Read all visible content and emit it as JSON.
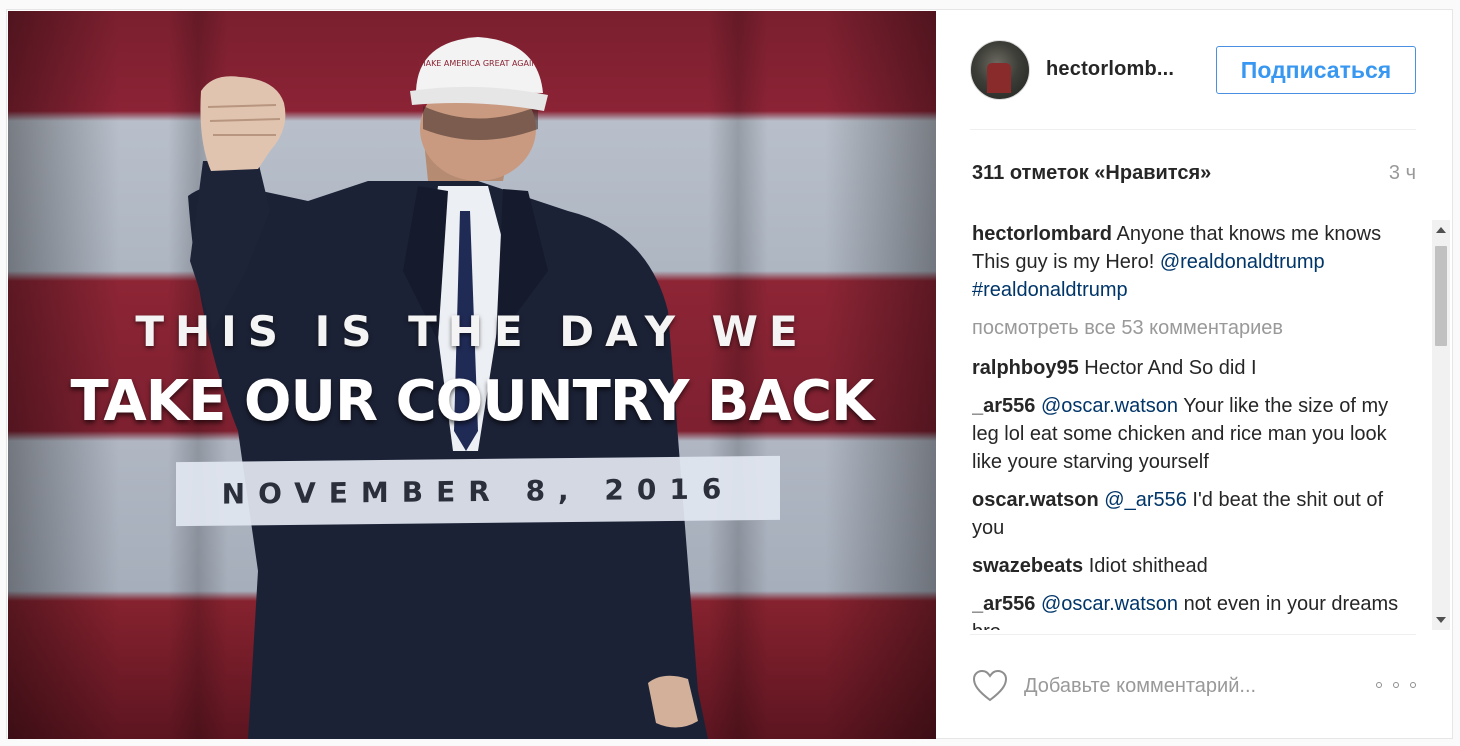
{
  "media": {
    "headline_line1": "THIS IS THE DAY WE",
    "headline_line2": "TAKE OUR COUNTRY BACK",
    "date_text": "NOVEMBER 8, 2016",
    "cap_text": "MAKE AMERICA GREAT AGAIN"
  },
  "header": {
    "username": "hectorlomb...",
    "follow_label": "Подписаться"
  },
  "stats": {
    "likes": "311 отметок «Нравится»",
    "time": "3 ч"
  },
  "caption": {
    "author": "hectorlombard",
    "text": "Anyone that knows me knows This guy is my Hero!",
    "mention": "@realdonaldtrump #realdonaldtrump"
  },
  "view_all_comments": "посмотреть все 53 комментариев",
  "comments": [
    {
      "author": "ralphboy95",
      "mention": "",
      "text": "Hector And So did I"
    },
    {
      "author": "_ar556",
      "mention": "@oscar.watson",
      "text": "Your like the size of my leg lol eat some chicken and rice man you look like youre starving yourself"
    },
    {
      "author": "oscar.watson",
      "mention": "@_ar556",
      "text": "I'd beat the shit out of you"
    },
    {
      "author": "swazebeats",
      "mention": "",
      "text": "Idiot shithead"
    },
    {
      "author": "_ar556",
      "mention": "@oscar.watson",
      "text": "not even in your dreams bro"
    }
  ],
  "comment_box": {
    "placeholder": "Добавьте комментарий..."
  },
  "icons": {
    "like": "heart-icon",
    "more": "more-options-icon"
  },
  "colors": {
    "accent": "#3897f0",
    "mention": "#003569",
    "muted": "#999999"
  }
}
